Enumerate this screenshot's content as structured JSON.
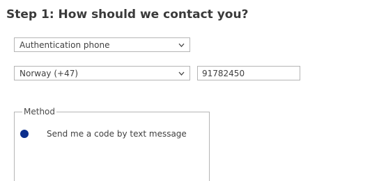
{
  "step": {
    "title": "Step 1: How should we contact you?"
  },
  "contact_method": {
    "selected": "Authentication phone",
    "icon": "chevron-down-icon"
  },
  "country": {
    "selected": "Norway (+47)",
    "icon": "chevron-down-icon"
  },
  "phone": {
    "value": "91782450"
  },
  "method": {
    "legend": "Method",
    "options": [
      {
        "label": "Send me a code by text message",
        "selected": true
      }
    ]
  },
  "colors": {
    "radio_selected": "#0b2e8c",
    "border": "#b5b5b5"
  }
}
